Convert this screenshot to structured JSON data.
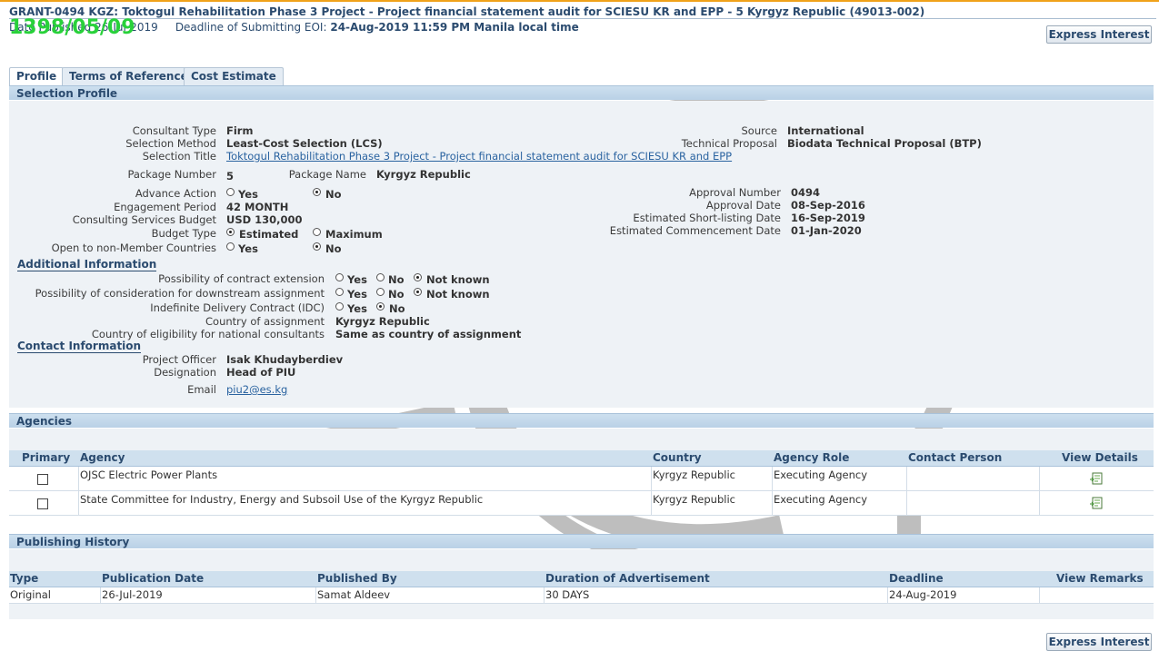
{
  "header": {
    "title": "GRANT-0494 KGZ: Toktogul Rehabilitation Phase 3 Project - Project financial statement audit for SCIESU KR and EPP - 5 Kyrgyz Republic (49013-002)",
    "date_label": "Date Published",
    "date_value": "26-Jul-2019",
    "deadline_label": "Deadline of Submitting EOI:",
    "deadline_value": "24-Aug-2019 11:59 PM Manila local time",
    "stamp": "1398/05/09",
    "express_button": "Express Interest"
  },
  "tabs": [
    {
      "label": "Profile"
    },
    {
      "label": "Terms of Reference"
    },
    {
      "label": "Cost Estimate"
    }
  ],
  "selection_profile": {
    "section_title": "Selection Profile",
    "consultant_type": {
      "label": "Consultant Type",
      "value": "Firm"
    },
    "selection_method": {
      "label": "Selection Method",
      "value": "Least-Cost Selection (LCS)"
    },
    "selection_title": {
      "label": "Selection Title",
      "value": "Toktogul Rehabilitation Phase 3 Project - Project financial statement audit for SCIESU KR and EPP"
    },
    "package_number": {
      "label": "Package Number",
      "value": "5"
    },
    "package_name": {
      "label": "Package Name",
      "value": "Kyrgyz Republic"
    },
    "advance_action": {
      "label": "Advance Action",
      "yes": "Yes",
      "no": "No",
      "selected": "No"
    },
    "engagement_period": {
      "label": "Engagement Period",
      "value": "42 MONTH"
    },
    "services_budget": {
      "label": "Consulting Services Budget",
      "value": "USD 130,000"
    },
    "budget_type": {
      "label": "Budget Type",
      "estimated": "Estimated",
      "maximum": "Maximum",
      "selected": "Estimated"
    },
    "open_non_member": {
      "label": "Open to non-Member Countries",
      "yes": "Yes",
      "no": "No",
      "selected": "No"
    },
    "source": {
      "label": "Source",
      "value": "International"
    },
    "technical_proposal": {
      "label": "Technical Proposal",
      "value": "Biodata Technical Proposal (BTP)"
    },
    "approval_number": {
      "label": "Approval Number",
      "value": "0494"
    },
    "approval_date": {
      "label": "Approval Date",
      "value": "08-Sep-2016"
    },
    "shortlisting_date": {
      "label": "Estimated Short-listing Date",
      "value": "16-Sep-2019"
    },
    "commencement_date": {
      "label": "Estimated Commencement Date",
      "value": "01-Jan-2020"
    }
  },
  "additional_info": {
    "title": "Additional Information",
    "contract_extension": {
      "label": "Possibility of contract extension",
      "yes": "Yes",
      "no": "No",
      "not_known": "Not known",
      "selected": "Not known"
    },
    "downstream": {
      "label": "Possibility of consideration for downstream assignment",
      "yes": "Yes",
      "no": "No",
      "not_known": "Not known",
      "selected": "Not known"
    },
    "idc": {
      "label": "Indefinite Delivery Contract (IDC)",
      "yes": "Yes",
      "no": "No",
      "selected": "No"
    },
    "country_assignment": {
      "label": "Country of assignment",
      "value": "Kyrgyz Republic"
    },
    "country_eligibility": {
      "label": "Country of eligibility for national consultants",
      "value": "Same as country of assignment"
    }
  },
  "contact_info": {
    "title": "Contact Information",
    "project_officer": {
      "label": "Project Officer",
      "value": "Isak Khudayberdiev"
    },
    "designation": {
      "label": "Designation",
      "value": "Head of PIU"
    },
    "email": {
      "label": "Email",
      "value": "piu2@es.kg"
    }
  },
  "agencies": {
    "section_title": "Agencies",
    "columns": [
      "Primary",
      "Agency",
      "Country",
      "Agency Role",
      "Contact Person",
      "View Details"
    ],
    "rows": [
      {
        "agency": "OJSC Electric Power Plants",
        "country": "Kyrgyz Republic",
        "role": "Executing Agency",
        "contact": ""
      },
      {
        "agency": "State Committee for Industry, Energy and Subsoil Use of the Kyrgyz Republic",
        "country": "Kyrgyz Republic",
        "role": "Executing Agency",
        "contact": ""
      }
    ]
  },
  "publishing_history": {
    "section_title": "Publishing History",
    "columns": [
      "Type",
      "Publication Date",
      "Published By",
      "Duration of Advertisement",
      "Deadline",
      "View Remarks"
    ],
    "rows": [
      {
        "type": "Original",
        "publication_date": "26-Jul-2019",
        "published_by": "Samat Aldeev",
        "duration": "30 DAYS",
        "deadline": "24-Aug-2019",
        "remarks": ""
      }
    ]
  },
  "colors": {
    "accent_orange": "#f0a21a",
    "header_blue": "#2b4b6f",
    "section_bar": "#cde0ef",
    "stamp_green": "#28d13a"
  }
}
